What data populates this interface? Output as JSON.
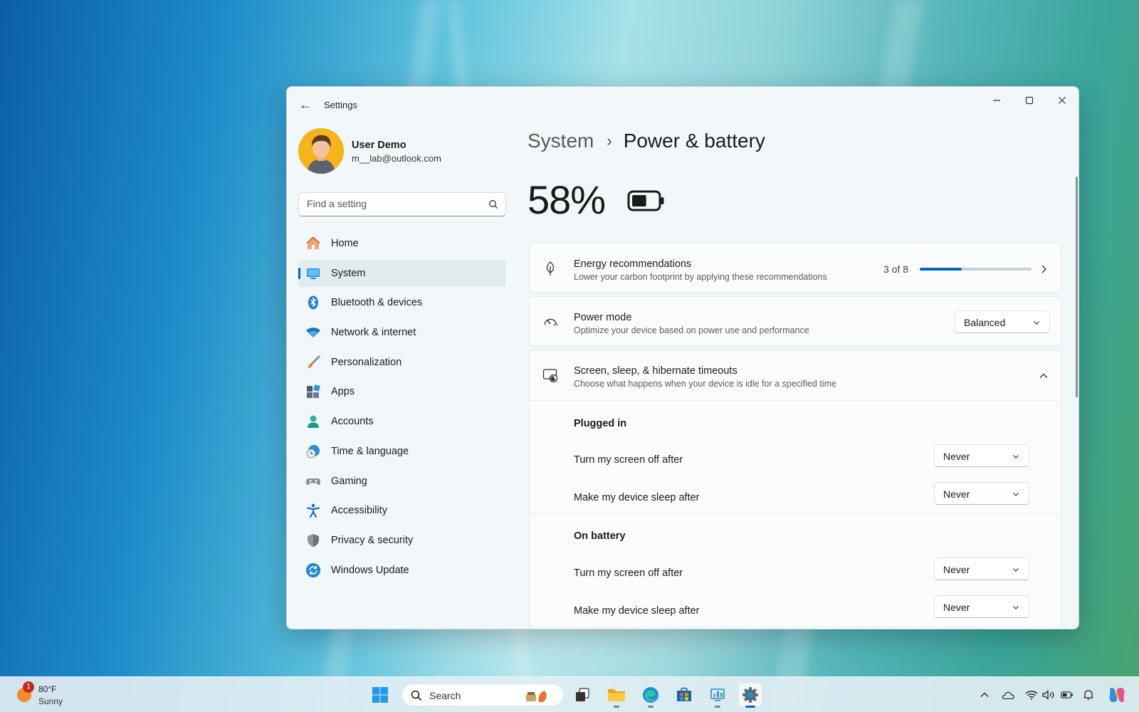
{
  "window": {
    "title": "Settings",
    "back_glyph": "←",
    "controls": {
      "minimize_glyph": "—",
      "close_glyph": "✕"
    }
  },
  "user": {
    "name": "User Demo",
    "email": "m__lab@outlook.com"
  },
  "search": {
    "placeholder": "Find a setting"
  },
  "nav": [
    {
      "label": "Home",
      "icon": "home-icon"
    },
    {
      "label": "System",
      "icon": "system-icon",
      "active": true
    },
    {
      "label": "Bluetooth & devices",
      "icon": "bluetooth-icon"
    },
    {
      "label": "Network & internet",
      "icon": "wifi-icon"
    },
    {
      "label": "Personalization",
      "icon": "brush-icon"
    },
    {
      "label": "Apps",
      "icon": "apps-icon"
    },
    {
      "label": "Accounts",
      "icon": "accounts-icon"
    },
    {
      "label": "Time & language",
      "icon": "globe-clock-icon"
    },
    {
      "label": "Gaming",
      "icon": "gamepad-icon"
    },
    {
      "label": "Accessibility",
      "icon": "accessibility-icon"
    },
    {
      "label": "Privacy & security",
      "icon": "shield-icon"
    },
    {
      "label": "Windows Update",
      "icon": "update-icon"
    }
  ],
  "header": {
    "parent": "System",
    "separator": "›",
    "title": "Power & battery"
  },
  "battery": {
    "percent_text": "58%",
    "level": 0.58
  },
  "energy": {
    "title": "Energy recommendations",
    "description": "Lower your carbon footprint by applying these recommendations",
    "progress_text": "3 of 8",
    "progress_done": 3,
    "progress_total": 8
  },
  "power_mode": {
    "title": "Power mode",
    "description": "Optimize your device based on power use and performance",
    "value": "Balanced"
  },
  "timeouts": {
    "title": "Screen, sleep, & hibernate timeouts",
    "description": "Choose what happens when your device is idle for a specified time",
    "plugged_in": {
      "label": "Plugged in",
      "screen_off": {
        "label": "Turn my screen off after",
        "value": "Never"
      },
      "sleep": {
        "label": "Make my device sleep after",
        "value": "Never"
      }
    },
    "on_battery": {
      "label": "On battery",
      "screen_off": {
        "label": "Turn my screen off after",
        "value": "Never"
      },
      "sleep": {
        "label": "Make my device sleep after",
        "value": "Never"
      }
    }
  },
  "taskbar": {
    "weather": {
      "badge": "1",
      "temp": "80°F",
      "condition": "Sunny"
    },
    "search_label": "Search",
    "pinned": [
      "start-icon",
      "task-view-icon",
      "file-explorer-icon",
      "edge-icon",
      "store-icon",
      "control-panel-icon",
      "settings-icon"
    ]
  },
  "colors": {
    "accent": "#0067c0",
    "window_bg": "#f2f8f9",
    "card_bg": "#fbfdfd"
  }
}
